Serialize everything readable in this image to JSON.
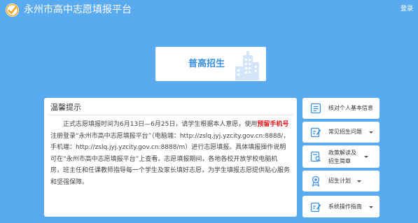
{
  "header": {
    "title": "永州市高中志愿填报平台",
    "login_label": "登录"
  },
  "colors": {
    "background": "#5aaaf0",
    "accent_blue": "#3b8fe2",
    "logo_orange": "#f5a623",
    "highlight_red": "#e8141b"
  },
  "main_card": {
    "label": "普高招生",
    "icon": "city-buildings-icon"
  },
  "notice": {
    "title": "温馨提示",
    "text_before": "正式志愿填报时间为6月13日—6月25日，请学生根据本人意愿，使用",
    "highlight": "预留手机号",
    "text_after": "注册登录“永州市高中志愿填报平台”（电脑端：http://zslq.jyj.yzcity.gov.cn:8888/，手机端：http://zslq.jyj.yzcity.gov.cn:8888/m）进行志愿填报。具体填报操作说明可在“永州市高中志愿填报平台”上查看。志愿填报期间，各地各校开放学校电脑机房，班主任和任课教师指导每一个学生及家长填好志愿，为学生填报志愿提供贴心服务和坚强保障。"
  },
  "side_menu": {
    "verify_info": {
      "label": "核对个人基本信息",
      "icon": "list-icon"
    },
    "faq": {
      "label": "常见招生问题",
      "icon": "edit-icon"
    },
    "policy_line1": "政策解读及",
    "policy_line2": "招生简章",
    "policy_icon": "document-search-icon",
    "plan": {
      "label": "招生计划",
      "icon": "badge-icon"
    },
    "guide": {
      "label": "系统操作指南",
      "icon": "guide-edit-icon"
    }
  }
}
